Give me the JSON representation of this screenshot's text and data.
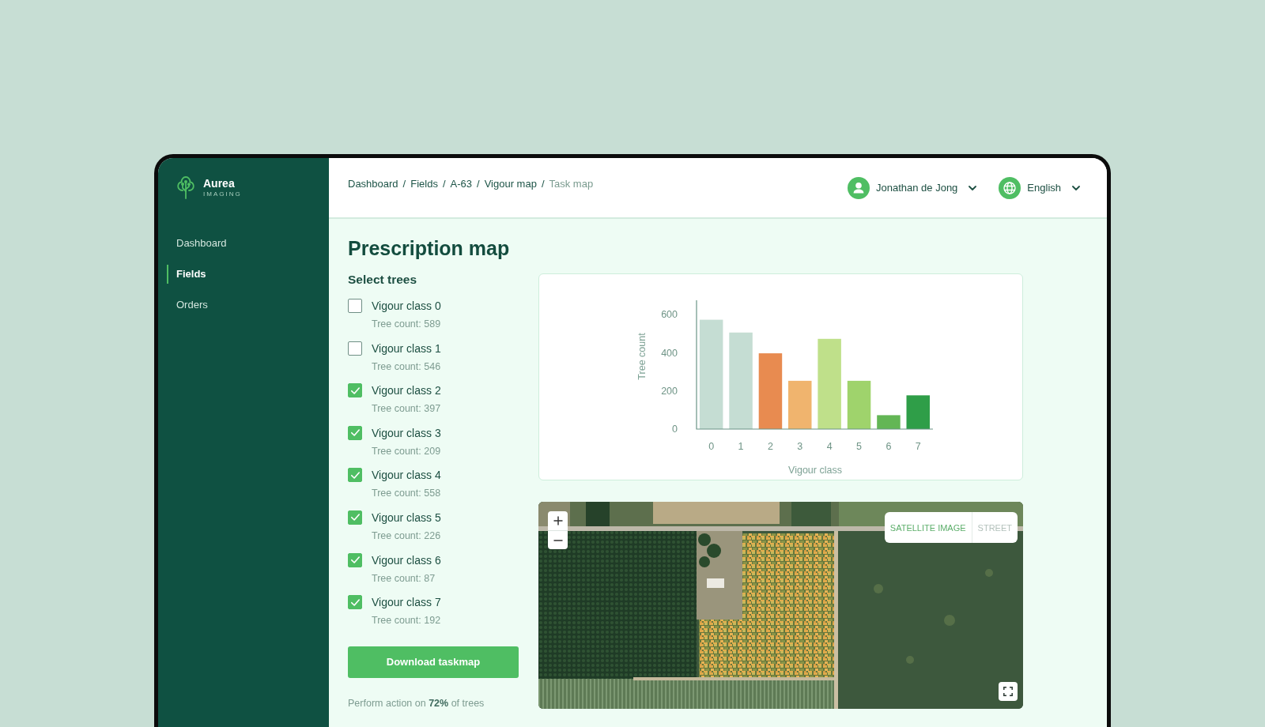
{
  "sidebar": {
    "logo": {
      "name": "Aurea",
      "tagline": "IMAGING"
    },
    "items": [
      {
        "label": "Dashboard",
        "selected": false
      },
      {
        "label": "Fields",
        "selected": true
      },
      {
        "label": "Orders",
        "selected": false
      }
    ]
  },
  "header": {
    "breadcrumb": [
      {
        "label": "Dashboard",
        "current": false,
        "separator": "/"
      },
      {
        "label": "Fields",
        "current": false,
        "separator": "/"
      },
      {
        "label": "A-63",
        "current": false,
        "separator": "/"
      },
      {
        "label": "Vigour map",
        "current": false,
        "separator": "/"
      },
      {
        "label": "Task map",
        "current": true
      }
    ],
    "user": {
      "name": "Jonathan de Jong"
    },
    "language": {
      "label": "English"
    }
  },
  "page": {
    "title": "Prescription map"
  },
  "tree_selection": {
    "heading": "Select trees",
    "classes": [
      {
        "label": "Vigour class 0",
        "count": "Tree count: 589",
        "checked": false
      },
      {
        "label": "Vigour class 1",
        "count": "Tree count: 546",
        "checked": false
      },
      {
        "label": "Vigour class 2",
        "count": "Tree count: 397",
        "checked": true
      },
      {
        "label": "Vigour class 3",
        "count": "Tree count: 209",
        "checked": true
      },
      {
        "label": "Vigour class 4",
        "count": "Tree count: 558",
        "checked": true
      },
      {
        "label": "Vigour class 5",
        "count": "Tree count: 226",
        "checked": true
      },
      {
        "label": "Vigour class 6",
        "count": "Tree count: 87",
        "checked": true
      },
      {
        "label": "Vigour class 7",
        "count": "Tree count: 192",
        "checked": true
      }
    ],
    "download_button": "Download taskmap",
    "summary": "Perform action on **72%** of trees"
  },
  "chart": {
    "chart_data": {
      "type": "bar",
      "xlabel": "Vigour class",
      "ylabel": "Tree count",
      "categories": [
        "0",
        "1",
        "2",
        "3",
        "4",
        "5",
        "6",
        "7"
      ],
      "series": [
        {
          "values": [
            573,
            506,
            397,
            253,
            473,
            253,
            73,
            177
          ],
          "colors": [
            "#c5ddd3",
            "#c5ddd3",
            "#e88b50",
            "#f0b46e",
            "#bfe08a",
            "#9fd36c",
            "#63b655",
            "#2f9e48"
          ]
        }
      ],
      "ylim": [
        0,
        675
      ],
      "yticks": [
        0,
        200,
        400,
        600
      ]
    }
  },
  "map": {
    "layers": [
      {
        "label": "SATELLITE IMAGE",
        "selected": true
      },
      {
        "label": "STREET",
        "selected": false
      }
    ]
  }
}
